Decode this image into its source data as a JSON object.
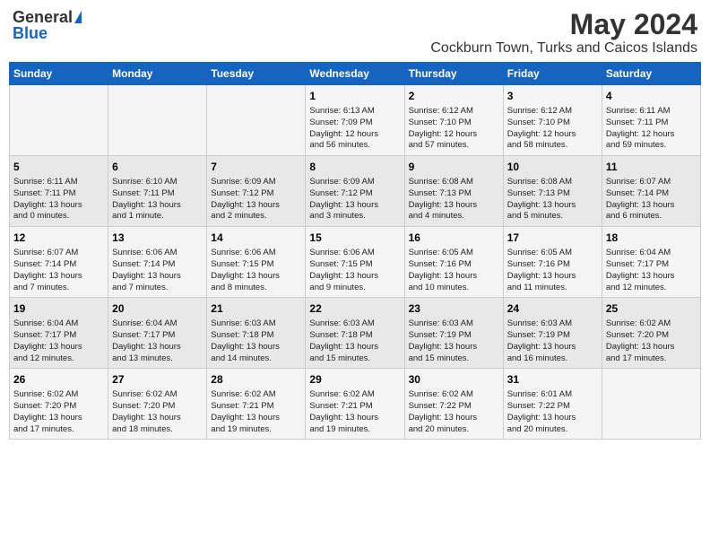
{
  "logo": {
    "general": "General",
    "blue": "Blue"
  },
  "title": "May 2024",
  "subtitle": "Cockburn Town, Turks and Caicos Islands",
  "days_of_week": [
    "Sunday",
    "Monday",
    "Tuesday",
    "Wednesday",
    "Thursday",
    "Friday",
    "Saturday"
  ],
  "weeks": [
    [
      {
        "day": "",
        "info": ""
      },
      {
        "day": "",
        "info": ""
      },
      {
        "day": "",
        "info": ""
      },
      {
        "day": "1",
        "info": "Sunrise: 6:13 AM\nSunset: 7:09 PM\nDaylight: 12 hours\nand 56 minutes."
      },
      {
        "day": "2",
        "info": "Sunrise: 6:12 AM\nSunset: 7:10 PM\nDaylight: 12 hours\nand 57 minutes."
      },
      {
        "day": "3",
        "info": "Sunrise: 6:12 AM\nSunset: 7:10 PM\nDaylight: 12 hours\nand 58 minutes."
      },
      {
        "day": "4",
        "info": "Sunrise: 6:11 AM\nSunset: 7:11 PM\nDaylight: 12 hours\nand 59 minutes."
      }
    ],
    [
      {
        "day": "5",
        "info": "Sunrise: 6:11 AM\nSunset: 7:11 PM\nDaylight: 13 hours\nand 0 minutes."
      },
      {
        "day": "6",
        "info": "Sunrise: 6:10 AM\nSunset: 7:11 PM\nDaylight: 13 hours\nand 1 minute."
      },
      {
        "day": "7",
        "info": "Sunrise: 6:09 AM\nSunset: 7:12 PM\nDaylight: 13 hours\nand 2 minutes."
      },
      {
        "day": "8",
        "info": "Sunrise: 6:09 AM\nSunset: 7:12 PM\nDaylight: 13 hours\nand 3 minutes."
      },
      {
        "day": "9",
        "info": "Sunrise: 6:08 AM\nSunset: 7:13 PM\nDaylight: 13 hours\nand 4 minutes."
      },
      {
        "day": "10",
        "info": "Sunrise: 6:08 AM\nSunset: 7:13 PM\nDaylight: 13 hours\nand 5 minutes."
      },
      {
        "day": "11",
        "info": "Sunrise: 6:07 AM\nSunset: 7:14 PM\nDaylight: 13 hours\nand 6 minutes."
      }
    ],
    [
      {
        "day": "12",
        "info": "Sunrise: 6:07 AM\nSunset: 7:14 PM\nDaylight: 13 hours\nand 7 minutes."
      },
      {
        "day": "13",
        "info": "Sunrise: 6:06 AM\nSunset: 7:14 PM\nDaylight: 13 hours\nand 7 minutes."
      },
      {
        "day": "14",
        "info": "Sunrise: 6:06 AM\nSunset: 7:15 PM\nDaylight: 13 hours\nand 8 minutes."
      },
      {
        "day": "15",
        "info": "Sunrise: 6:06 AM\nSunset: 7:15 PM\nDaylight: 13 hours\nand 9 minutes."
      },
      {
        "day": "16",
        "info": "Sunrise: 6:05 AM\nSunset: 7:16 PM\nDaylight: 13 hours\nand 10 minutes."
      },
      {
        "day": "17",
        "info": "Sunrise: 6:05 AM\nSunset: 7:16 PM\nDaylight: 13 hours\nand 11 minutes."
      },
      {
        "day": "18",
        "info": "Sunrise: 6:04 AM\nSunset: 7:17 PM\nDaylight: 13 hours\nand 12 minutes."
      }
    ],
    [
      {
        "day": "19",
        "info": "Sunrise: 6:04 AM\nSunset: 7:17 PM\nDaylight: 13 hours\nand 12 minutes."
      },
      {
        "day": "20",
        "info": "Sunrise: 6:04 AM\nSunset: 7:17 PM\nDaylight: 13 hours\nand 13 minutes."
      },
      {
        "day": "21",
        "info": "Sunrise: 6:03 AM\nSunset: 7:18 PM\nDaylight: 13 hours\nand 14 minutes."
      },
      {
        "day": "22",
        "info": "Sunrise: 6:03 AM\nSunset: 7:18 PM\nDaylight: 13 hours\nand 15 minutes."
      },
      {
        "day": "23",
        "info": "Sunrise: 6:03 AM\nSunset: 7:19 PM\nDaylight: 13 hours\nand 15 minutes."
      },
      {
        "day": "24",
        "info": "Sunrise: 6:03 AM\nSunset: 7:19 PM\nDaylight: 13 hours\nand 16 minutes."
      },
      {
        "day": "25",
        "info": "Sunrise: 6:02 AM\nSunset: 7:20 PM\nDaylight: 13 hours\nand 17 minutes."
      }
    ],
    [
      {
        "day": "26",
        "info": "Sunrise: 6:02 AM\nSunset: 7:20 PM\nDaylight: 13 hours\nand 17 minutes."
      },
      {
        "day": "27",
        "info": "Sunrise: 6:02 AM\nSunset: 7:20 PM\nDaylight: 13 hours\nand 18 minutes."
      },
      {
        "day": "28",
        "info": "Sunrise: 6:02 AM\nSunset: 7:21 PM\nDaylight: 13 hours\nand 19 minutes."
      },
      {
        "day": "29",
        "info": "Sunrise: 6:02 AM\nSunset: 7:21 PM\nDaylight: 13 hours\nand 19 minutes."
      },
      {
        "day": "30",
        "info": "Sunrise: 6:02 AM\nSunset: 7:22 PM\nDaylight: 13 hours\nand 20 minutes."
      },
      {
        "day": "31",
        "info": "Sunrise: 6:01 AM\nSunset: 7:22 PM\nDaylight: 13 hours\nand 20 minutes."
      },
      {
        "day": "",
        "info": ""
      }
    ]
  ]
}
